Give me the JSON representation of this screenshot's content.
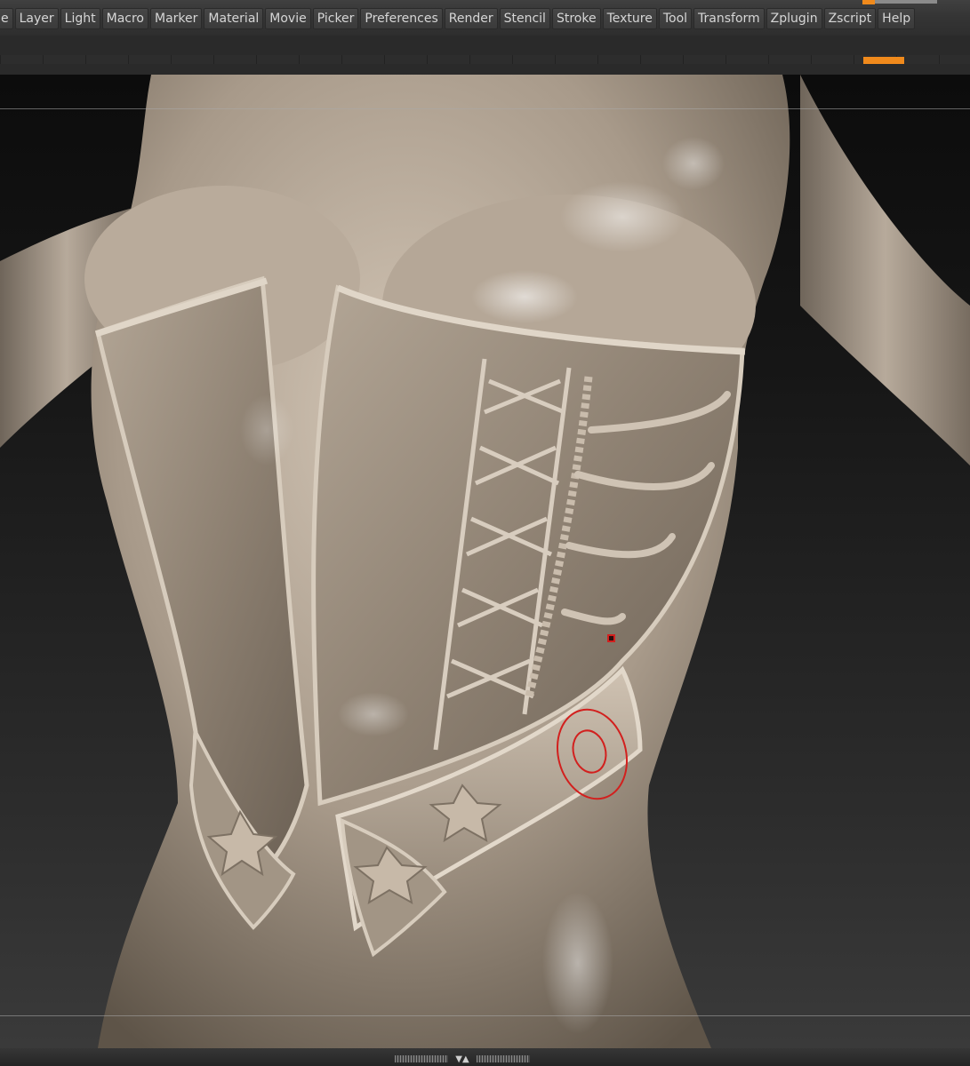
{
  "menubar": {
    "items": [
      {
        "label": "e"
      },
      {
        "label": "Layer"
      },
      {
        "label": "Light"
      },
      {
        "label": "Macro"
      },
      {
        "label": "Marker"
      },
      {
        "label": "Material"
      },
      {
        "label": "Movie"
      },
      {
        "label": "Picker"
      },
      {
        "label": "Preferences"
      },
      {
        "label": "Render"
      },
      {
        "label": "Stencil"
      },
      {
        "label": "Stroke"
      },
      {
        "label": "Texture"
      },
      {
        "label": "Tool"
      },
      {
        "label": "Transform"
      },
      {
        "label": "Zplugin"
      },
      {
        "label": "Zscript"
      },
      {
        "label": "Help"
      }
    ]
  },
  "colors": {
    "accent": "#f08a1c",
    "brush_cursor": "#d2201e",
    "model": "#b7aa9b",
    "background_top": "#0c0c0c",
    "background_bottom": "#3a3a3a"
  },
  "viewport": {
    "content": "3D sculpt of a female torso wearing an ornate corset",
    "brush_cursor": "red-circle-icon"
  },
  "bottombar": {
    "collapse_icon": "collapse-arrows-icon",
    "arrows": "▼▲"
  }
}
